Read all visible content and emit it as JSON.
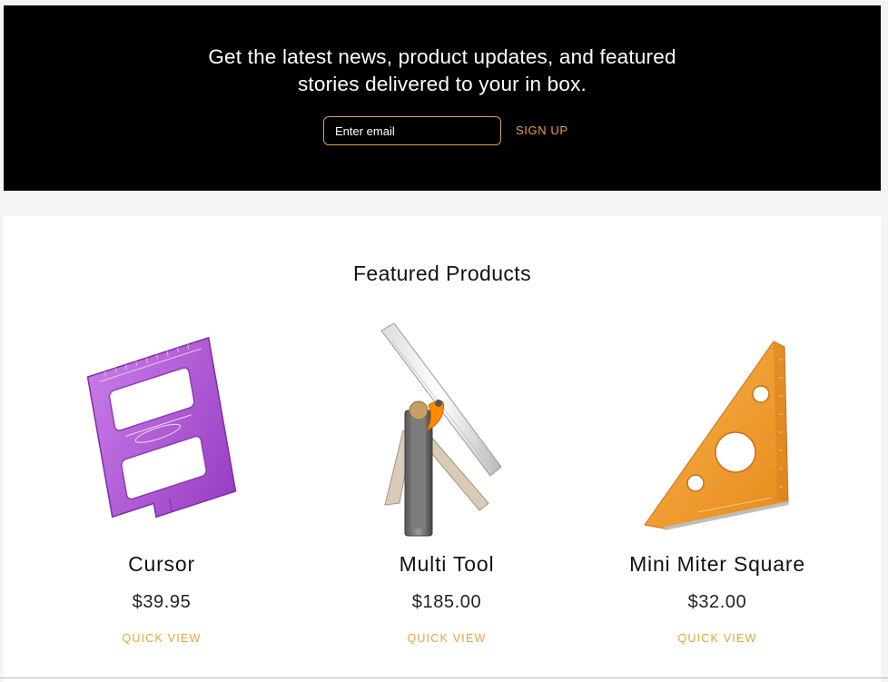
{
  "newsletter": {
    "heading_line1": "Get the latest news, product updates, and featured",
    "heading_line2": "stories delivered to your in box.",
    "email_placeholder": "Enter email",
    "signup_label": "SIGN UP"
  },
  "featured": {
    "title": "Featured Products",
    "products": [
      {
        "name": "Cursor",
        "price": "$39.95",
        "quick_view": "QUICK VIEW",
        "image_icon": "cursor-tool-icon",
        "color": "#b561d8"
      },
      {
        "name": "Multi Tool",
        "price": "$185.00",
        "quick_view": "QUICK VIEW",
        "image_icon": "multi-tool-icon",
        "color": "#ff8a00"
      },
      {
        "name": "Mini Miter Square",
        "price": "$32.00",
        "quick_view": "QUICK VIEW",
        "image_icon": "miter-square-icon",
        "color": "#f39a2e"
      }
    ]
  },
  "colors": {
    "accent": "#e8a33c",
    "newsletter_bg": "#000000",
    "page_bg": "#f4f4f4"
  }
}
